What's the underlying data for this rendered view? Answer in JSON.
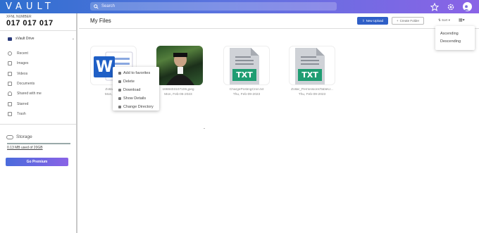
{
  "topbar": {
    "logo": "VAULT",
    "search_placeholder": "Search",
    "icons": [
      "star-icon",
      "gear-icon",
      "user-avatar-icon"
    ],
    "brand_colors": [
      "#2f6fcf",
      "#8a63e6"
    ]
  },
  "sidebar": {
    "xnum_label": "XFNL NUMBER",
    "xnum": "017 017 017",
    "drive_label": "xVault Drive",
    "items": [
      {
        "label": "Recent",
        "icon": "clock-icon"
      },
      {
        "label": "Images",
        "icon": "image-icon"
      },
      {
        "label": "Videos",
        "icon": "video-icon"
      },
      {
        "label": "Documents",
        "icon": "document-icon"
      },
      {
        "label": "Shared with me",
        "icon": "shared-icon"
      },
      {
        "label": "Starred",
        "icon": "star-icon"
      },
      {
        "label": "Trash",
        "icon": "trash-icon"
      }
    ],
    "storage_label": "Storage",
    "storage_used": "0.13 MB used of 20GB",
    "premium_label": "Go Premium"
  },
  "main": {
    "title": "My Files",
    "new_upload": "New Upload",
    "create_folder": "Create Folder",
    "sort_label": "Sort",
    "sort_options": [
      "Ascending",
      "Descending"
    ],
    "files": [
      {
        "name": "Zollar Nc...",
        "date": "Mon, Feb...",
        "type": "word"
      },
      {
        "name": "1668403107106.jpeg",
        "date": "Mon, Feb-06-2023",
        "type": "image"
      },
      {
        "name": "ChargePostingCron.txt",
        "date": "Thu, Feb-09-2023",
        "type": "txt"
      },
      {
        "name": "Zollar_PermissionsTableU...",
        "date": "Thu, Feb-09-2023",
        "type": "txt"
      }
    ],
    "context_menu": [
      "Add to favorites",
      "Delete",
      "Download",
      "Show Details",
      "Change Directory"
    ],
    "txt_badge": "TXT"
  }
}
